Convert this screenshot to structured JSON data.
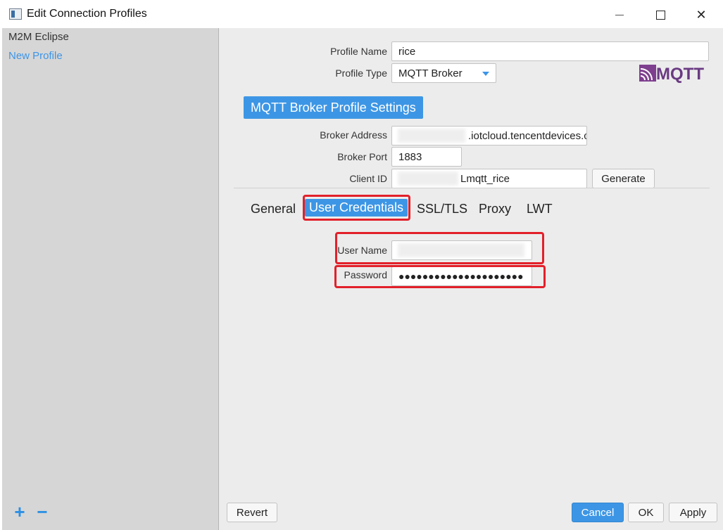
{
  "window": {
    "title": "Edit Connection Profiles"
  },
  "sidebar": {
    "items": [
      {
        "label": "M2M Eclipse"
      },
      {
        "label": "New Profile"
      }
    ],
    "add_icon": "plus-icon",
    "remove_icon": "minus-icon"
  },
  "profile": {
    "name_label": "Profile Name",
    "name_value": "rice",
    "type_label": "Profile Type",
    "type_value": "MQTT Broker",
    "logo_text": "MQTT"
  },
  "section": {
    "title": "MQTT Broker Profile Settings"
  },
  "broker": {
    "address_label": "Broker Address",
    "address_value": ".iotcloud.tencentdevices.c",
    "port_label": "Broker Port",
    "port_value": "1883",
    "client_id_label": "Client ID",
    "client_id_value": "Lmqtt_rice",
    "generate_label": "Generate"
  },
  "tabs": [
    {
      "label": "General"
    },
    {
      "label": "User Credentials"
    },
    {
      "label": "SSL/TLS"
    },
    {
      "label": "Proxy"
    },
    {
      "label": "LWT"
    }
  ],
  "credentials": {
    "username_label": "User Name",
    "username_value": "",
    "password_label": "Password",
    "password_value": "●●●●●●●●●●●●●●●●●●●●●"
  },
  "footer": {
    "revert_label": "Revert",
    "cancel_label": "Cancel",
    "ok_label": "OK",
    "apply_label": "Apply"
  },
  "colors": {
    "accent": "#3d96e5",
    "highlight": "#e2202a"
  }
}
